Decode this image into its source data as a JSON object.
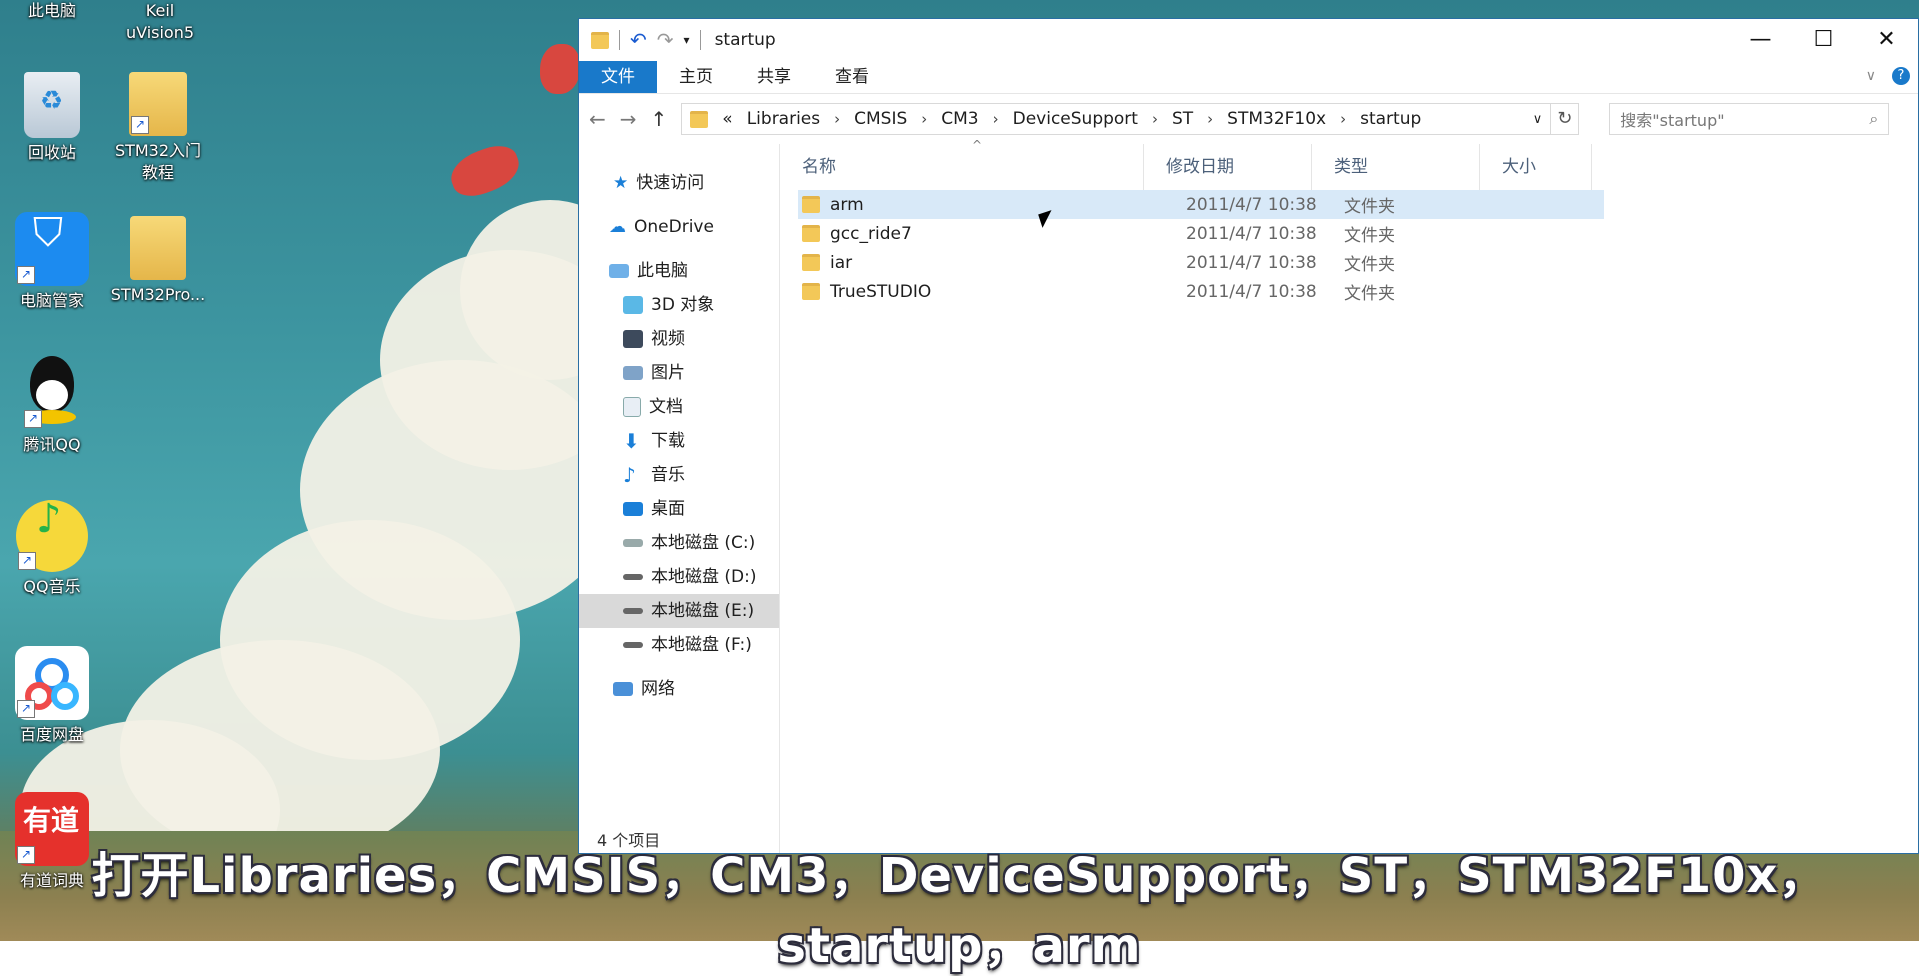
{
  "desktop": {
    "icons": [
      {
        "label": "此电脑"
      },
      {
        "label": "Keil uVision5"
      },
      {
        "label": "回收站"
      },
      {
        "label": "STM32入门教程"
      },
      {
        "label": "电脑管家"
      },
      {
        "label": "STM32Pro..."
      },
      {
        "label": "腾讯QQ"
      },
      {
        "label": "QQ音乐"
      },
      {
        "label": "百度网盘"
      },
      {
        "label": "有道词典"
      }
    ]
  },
  "window": {
    "title": "startup",
    "ribbon_tabs": [
      "文件",
      "主页",
      "共享",
      "查看"
    ],
    "address": {
      "prefix": "«",
      "crumbs": [
        "Libraries",
        "CMSIS",
        "CM3",
        "DeviceSupport",
        "ST",
        "STM32F10x",
        "startup"
      ]
    },
    "search_placeholder": "搜索\"startup\"",
    "nav": {
      "quick_access": "快速访问",
      "onedrive": "OneDrive",
      "this_pc": "此电脑",
      "items": [
        "3D 对象",
        "视频",
        "图片",
        "文档",
        "下载",
        "音乐",
        "桌面",
        "本地磁盘 (C:)",
        "本地磁盘 (D:)",
        "本地磁盘 (E:)",
        "本地磁盘 (F:)"
      ],
      "network": "网络"
    },
    "columns": [
      "名称",
      "修改日期",
      "类型",
      "大小"
    ],
    "files": [
      {
        "name": "arm",
        "date": "2011/4/7 10:38",
        "type": "文件夹"
      },
      {
        "name": "gcc_ride7",
        "date": "2011/4/7 10:38",
        "type": "文件夹"
      },
      {
        "name": "iar",
        "date": "2011/4/7 10:38",
        "type": "文件夹"
      },
      {
        "name": "TrueSTUDIO",
        "date": "2011/4/7 10:38",
        "type": "文件夹"
      }
    ],
    "status": "4 个项目"
  },
  "subtitle": "打开Libraries，CMSIS，CM3，DeviceSupport，ST，STM32F10x，startup，arm"
}
